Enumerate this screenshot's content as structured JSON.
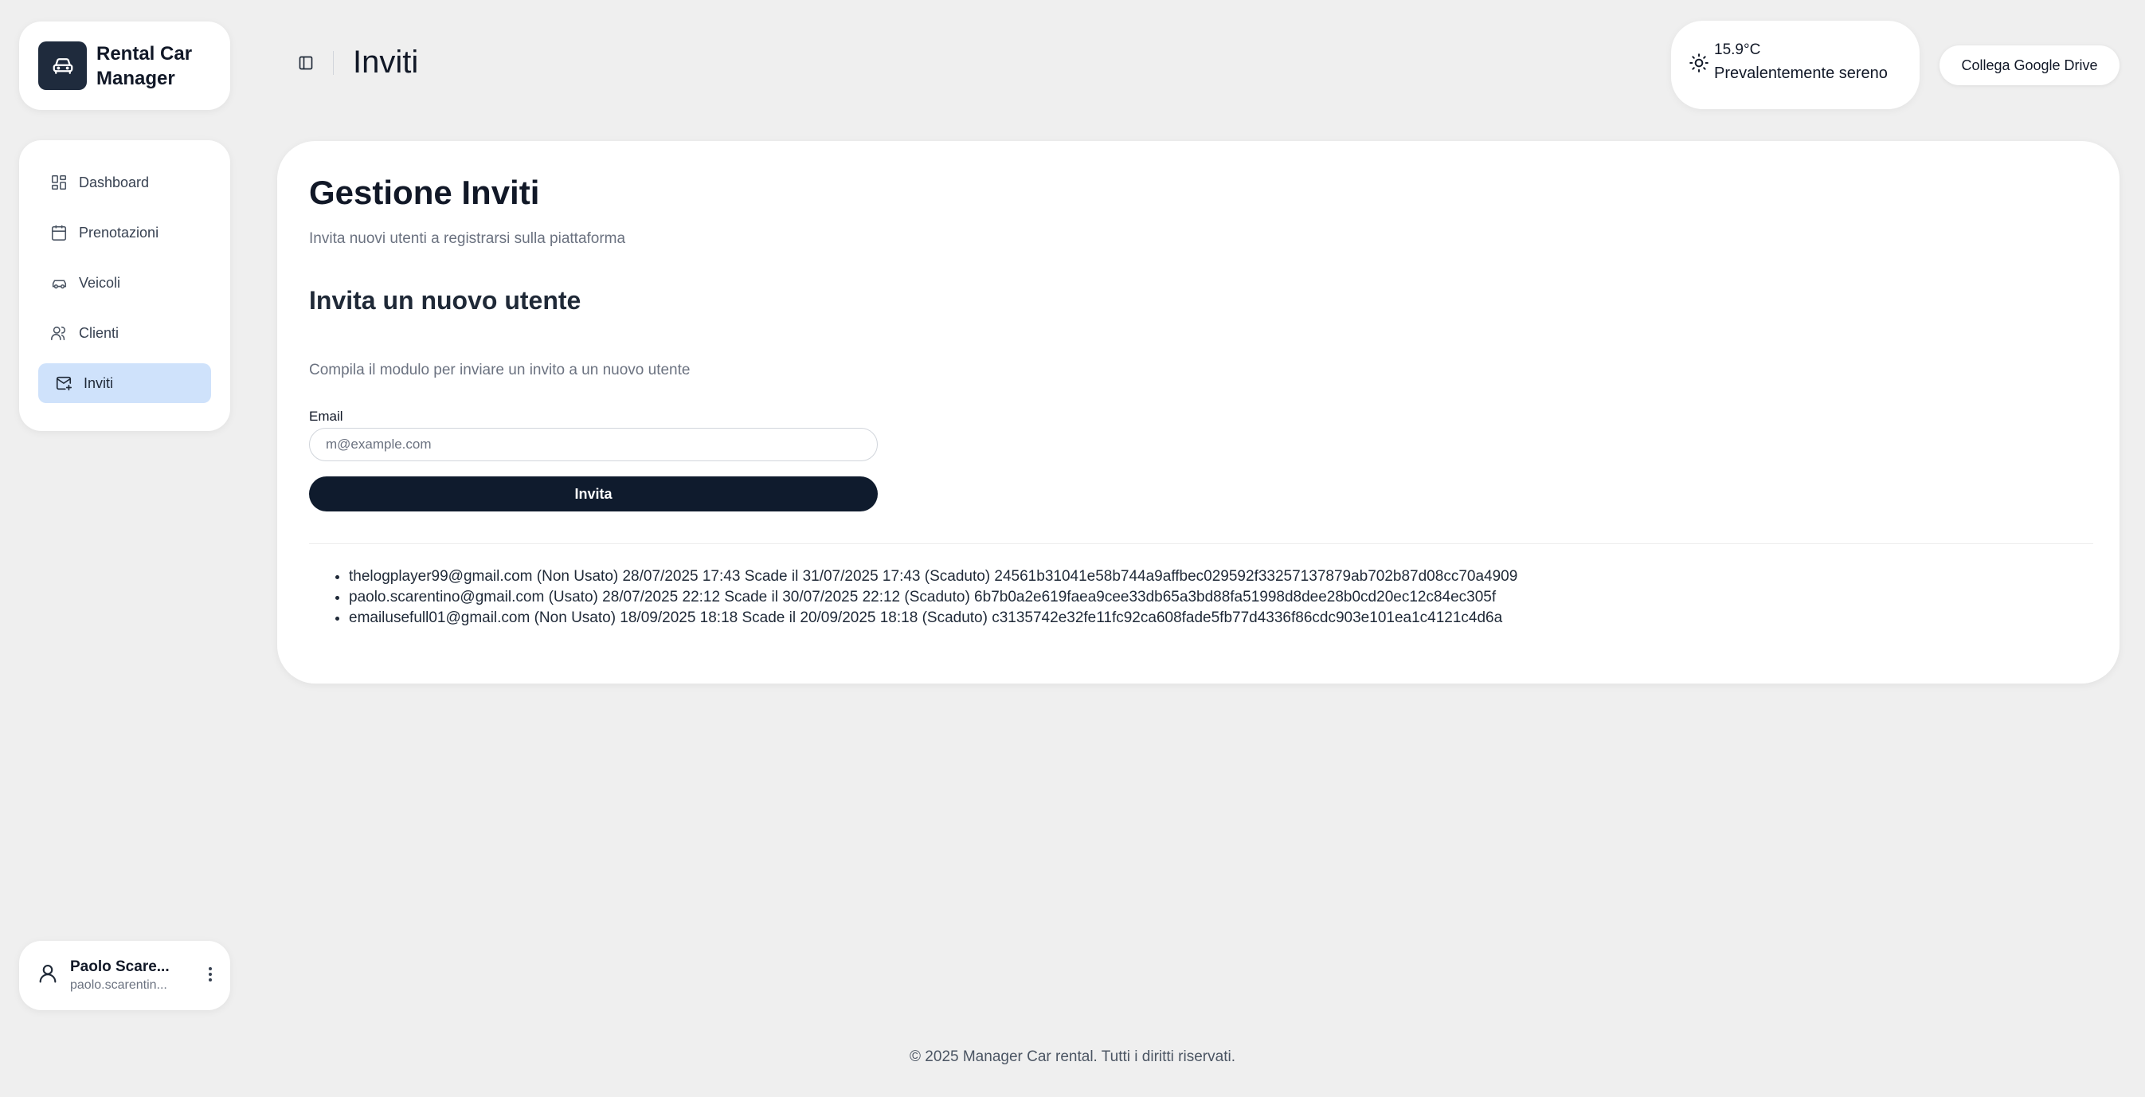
{
  "brand": {
    "name": "Rental Car Manager",
    "icon": "car-icon"
  },
  "sidebar": {
    "items": [
      {
        "label": "Dashboard",
        "icon": "dashboard-icon",
        "active": false
      },
      {
        "label": "Prenotazioni",
        "icon": "calendar-icon",
        "active": false
      },
      {
        "label": "Veicoli",
        "icon": "car-icon",
        "active": false
      },
      {
        "label": "Clienti",
        "icon": "users-icon",
        "active": false
      },
      {
        "label": "Inviti",
        "icon": "mail-plus-icon",
        "active": true
      }
    ]
  },
  "user": {
    "name": "Paolo Scare...",
    "email": "paolo.scarentin...",
    "icon": "user-icon",
    "menu_icon": "more-vertical-icon"
  },
  "header": {
    "title": "Inviti",
    "toggle_icon": "sidebar-toggle-icon"
  },
  "weather": {
    "temperature": "15.9°C",
    "description": "Prevalentemente sereno",
    "icon": "sun-icon"
  },
  "gdrive": {
    "label": "Collega Google Drive"
  },
  "main": {
    "title": "Gestione Inviti",
    "subtitle": "Invita nuovi utenti a registrarsi sulla piattaforma",
    "section_title": "Invita un nuovo utente",
    "section_subtitle": "Compila il modulo per inviare un invito a un nuovo utente",
    "email_label": "Email",
    "email_placeholder": "m@example.com",
    "email_value": "",
    "invite_button": "Invita",
    "invites": [
      "thelogplayer99@gmail.com (Non Usato) 28/07/2025 17:43 Scade il 31/07/2025 17:43 (Scaduto) 24561b31041e58b744a9affbec029592f33257137879ab702b87d08cc70a4909",
      "paolo.scarentino@gmail.com (Usato) 28/07/2025 22:12 Scade il 30/07/2025 22:12 (Scaduto) 6b7b0a2e619faea9cee33db65a3bd88fa51998d8dee28b0cd20ec12c84ec305f",
      "emailusefull01@gmail.com (Non Usato) 18/09/2025 18:18 Scade il 20/09/2025 18:18 (Scaduto) c3135742e32fe11fc92ca608fade5fb77d4336f86cdc903e101ea1c4121c4d6a"
    ]
  },
  "footer": {
    "text": "© 2025 Manager Car rental. Tutti i diritti riservati."
  },
  "colors": {
    "active_nav": "#cfe2fb",
    "primary_button": "#0f1b2d",
    "brand_logo_bg": "#1f2b3d",
    "background": "#efefef"
  }
}
